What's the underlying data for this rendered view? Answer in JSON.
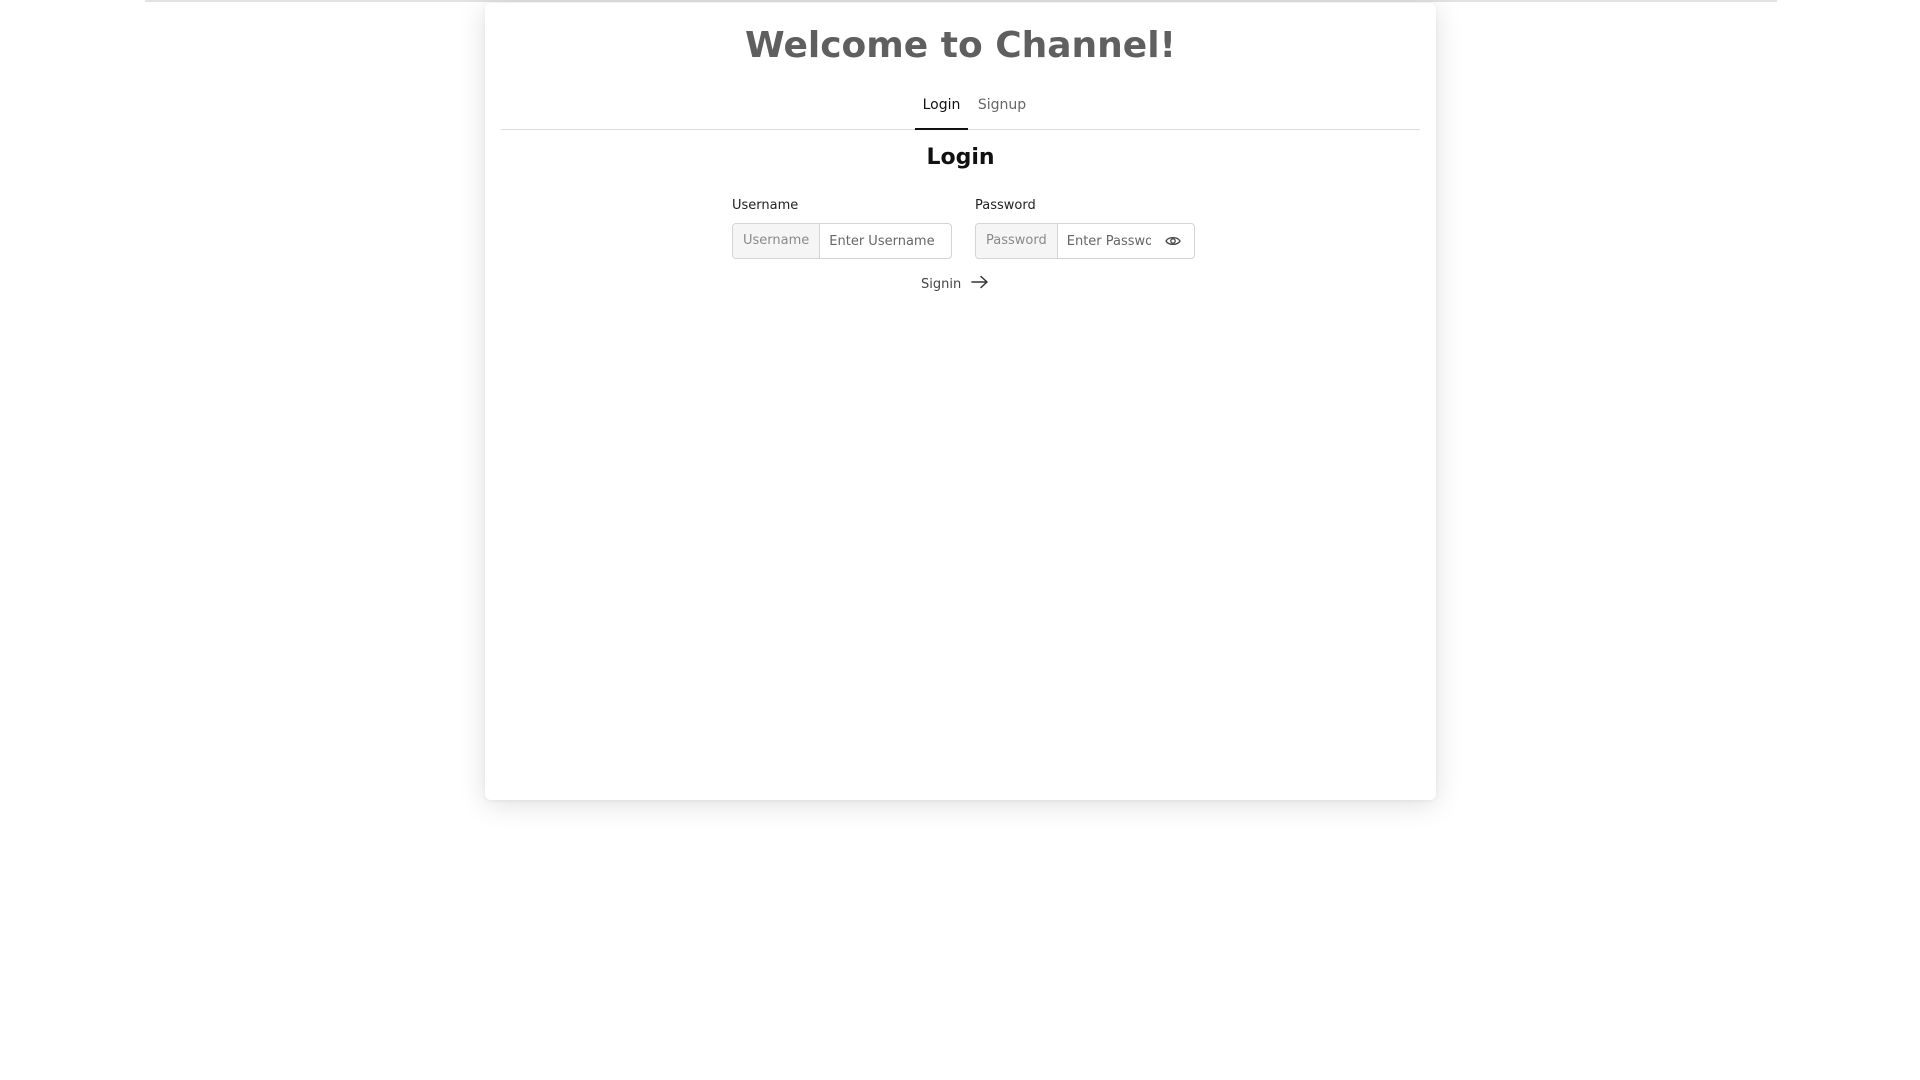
{
  "page": {
    "title": "Welcome to Channel!"
  },
  "tabs": [
    {
      "label": "Login",
      "active": true
    },
    {
      "label": "Signup",
      "active": false
    }
  ],
  "form": {
    "heading": "Login",
    "username": {
      "label": "Username",
      "addon": "Username",
      "placeholder": "Enter Username",
      "value": ""
    },
    "password": {
      "label": "Password",
      "addon": "Password",
      "placeholder": "Enter Password",
      "value": ""
    },
    "submit_label": "Signin"
  },
  "icons": {
    "password_toggle": "eye-icon",
    "submit": "arrow-right-icon"
  },
  "colors": {
    "title": "#5f5f5f",
    "active_tab_underline": "#111111"
  }
}
